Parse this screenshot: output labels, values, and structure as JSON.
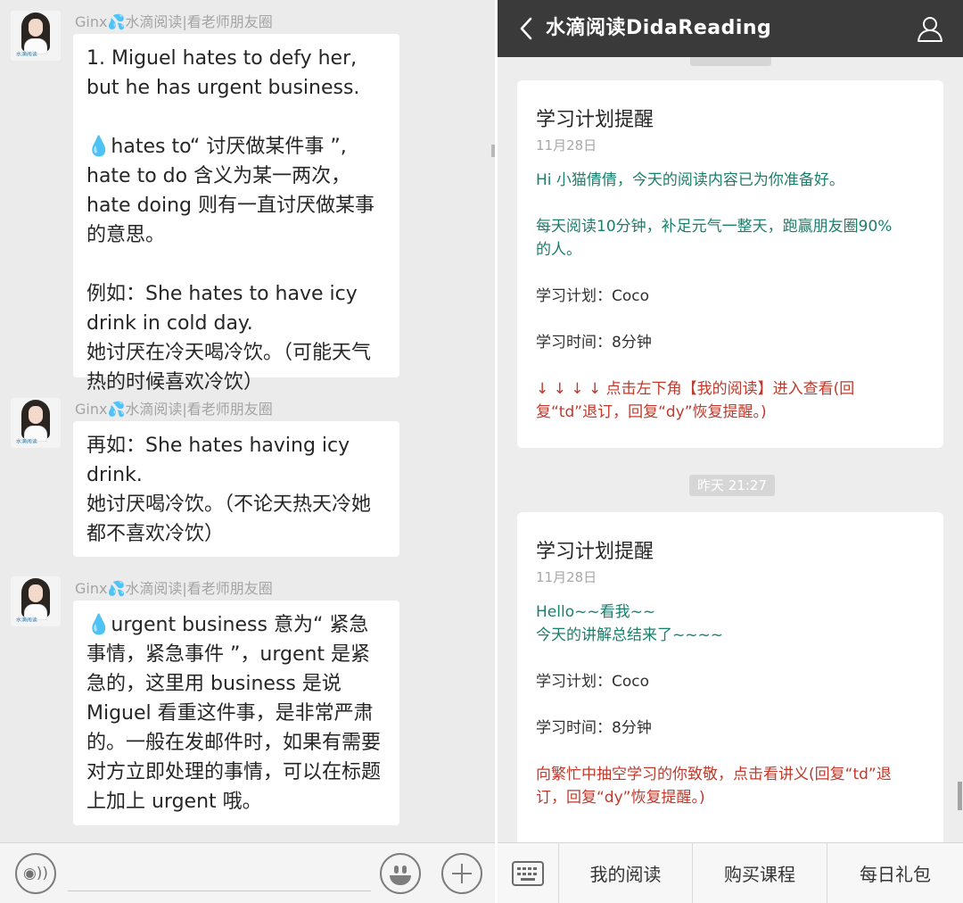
{
  "left_chat": {
    "avatar_tag": "水滴阅读",
    "messages": [
      {
        "sender_prefix": "Ginx",
        "sender_suffix": "水滴阅读|看老师朋友圈",
        "paragraphs": [
          "1. Miguel hates to defy her, but he has urgent business."
        ]
      },
      {
        "paragraphs": [
          "hates to“ 讨厌做某件事 ”, hate to do 含义为某一两次，hate doing 则有一直讨厌做某事的意思。",
          "例如：She hates to have icy drink in cold day.\n她讨厌在冷天喝冷饮。（可能天气热的时候喜欢冷饮）"
        ]
      },
      {
        "sender_prefix": "Ginx",
        "sender_suffix": "水滴阅读|看老师朋友圈",
        "paragraphs": [
          "再如：She hates having icy drink.\n她讨厌喝冷饮。（不论天热天冷她都不喜欢冷饮）"
        ]
      },
      {
        "sender_prefix": "Ginx",
        "sender_suffix": "水滴阅读|看老师朋友圈",
        "paragraphs": [
          "urgent business 意为“ 紧急事情，紧急事件 ”，urgent 是紧急的，这里用 business 是说 Miguel 看重这件事，是非常严肃的。一般在发邮件时，如果有需要对方立即处理的事情，可以在标题上加上 urgent 哦。"
        ]
      }
    ],
    "input_bar": {
      "voice_icon": "voice-icon",
      "emoji_icon": "emoji-icon",
      "plus_icon": "plus-icon"
    }
  },
  "right_chat": {
    "header": {
      "back_icon": "chevron-left-icon",
      "title": "水滴阅读DidaReading",
      "profile_icon": "user-icon",
      "background": "#3a3a3a"
    },
    "cards": [
      {
        "title": "学习计划提醒",
        "date": "11月28日",
        "lines": [
          {
            "text": "Hi 小猫倩倩，今天的阅读内容已为你准备好。",
            "tone": "teal"
          },
          {
            "text": "每天阅读10分钟，补足元气一整天，跑赢朋友圈90%\n的人。",
            "tone": "teal"
          },
          {
            "text": "学习计划：Coco",
            "tone": "dark"
          },
          {
            "text": "学习时间：8分钟",
            "tone": "dark"
          },
          {
            "text": "↓ ↓ ↓ ↓ 点击左下角【我的阅读】进入查看(回\n复“td”退订，回复“dy”恢复提醒。)",
            "tone": "red"
          }
        ]
      },
      {
        "title": "学习计划提醒",
        "date": "11月28日",
        "lines": [
          {
            "text": "Hello~~看我~~\n今天的讲解总结来了~~~~",
            "tone": "teal"
          },
          {
            "text": "学习计划：Coco",
            "tone": "dark"
          },
          {
            "text": "学习时间：8分钟",
            "tone": "dark"
          },
          {
            "text": "向繁忙中抽空学习的你致敬，点击看讲义(回复“td”退\n订，回复“dy”恢复提醒。)",
            "tone": "red"
          }
        ]
      }
    ],
    "timestamp": "昨天 21:27",
    "menu": {
      "keyboard_icon": "keyboard-icon",
      "items": [
        "我的阅读",
        "购买课程",
        "每日礼包"
      ]
    },
    "colors": {
      "teal": "#1a7f6b",
      "red": "#c0392b"
    }
  }
}
